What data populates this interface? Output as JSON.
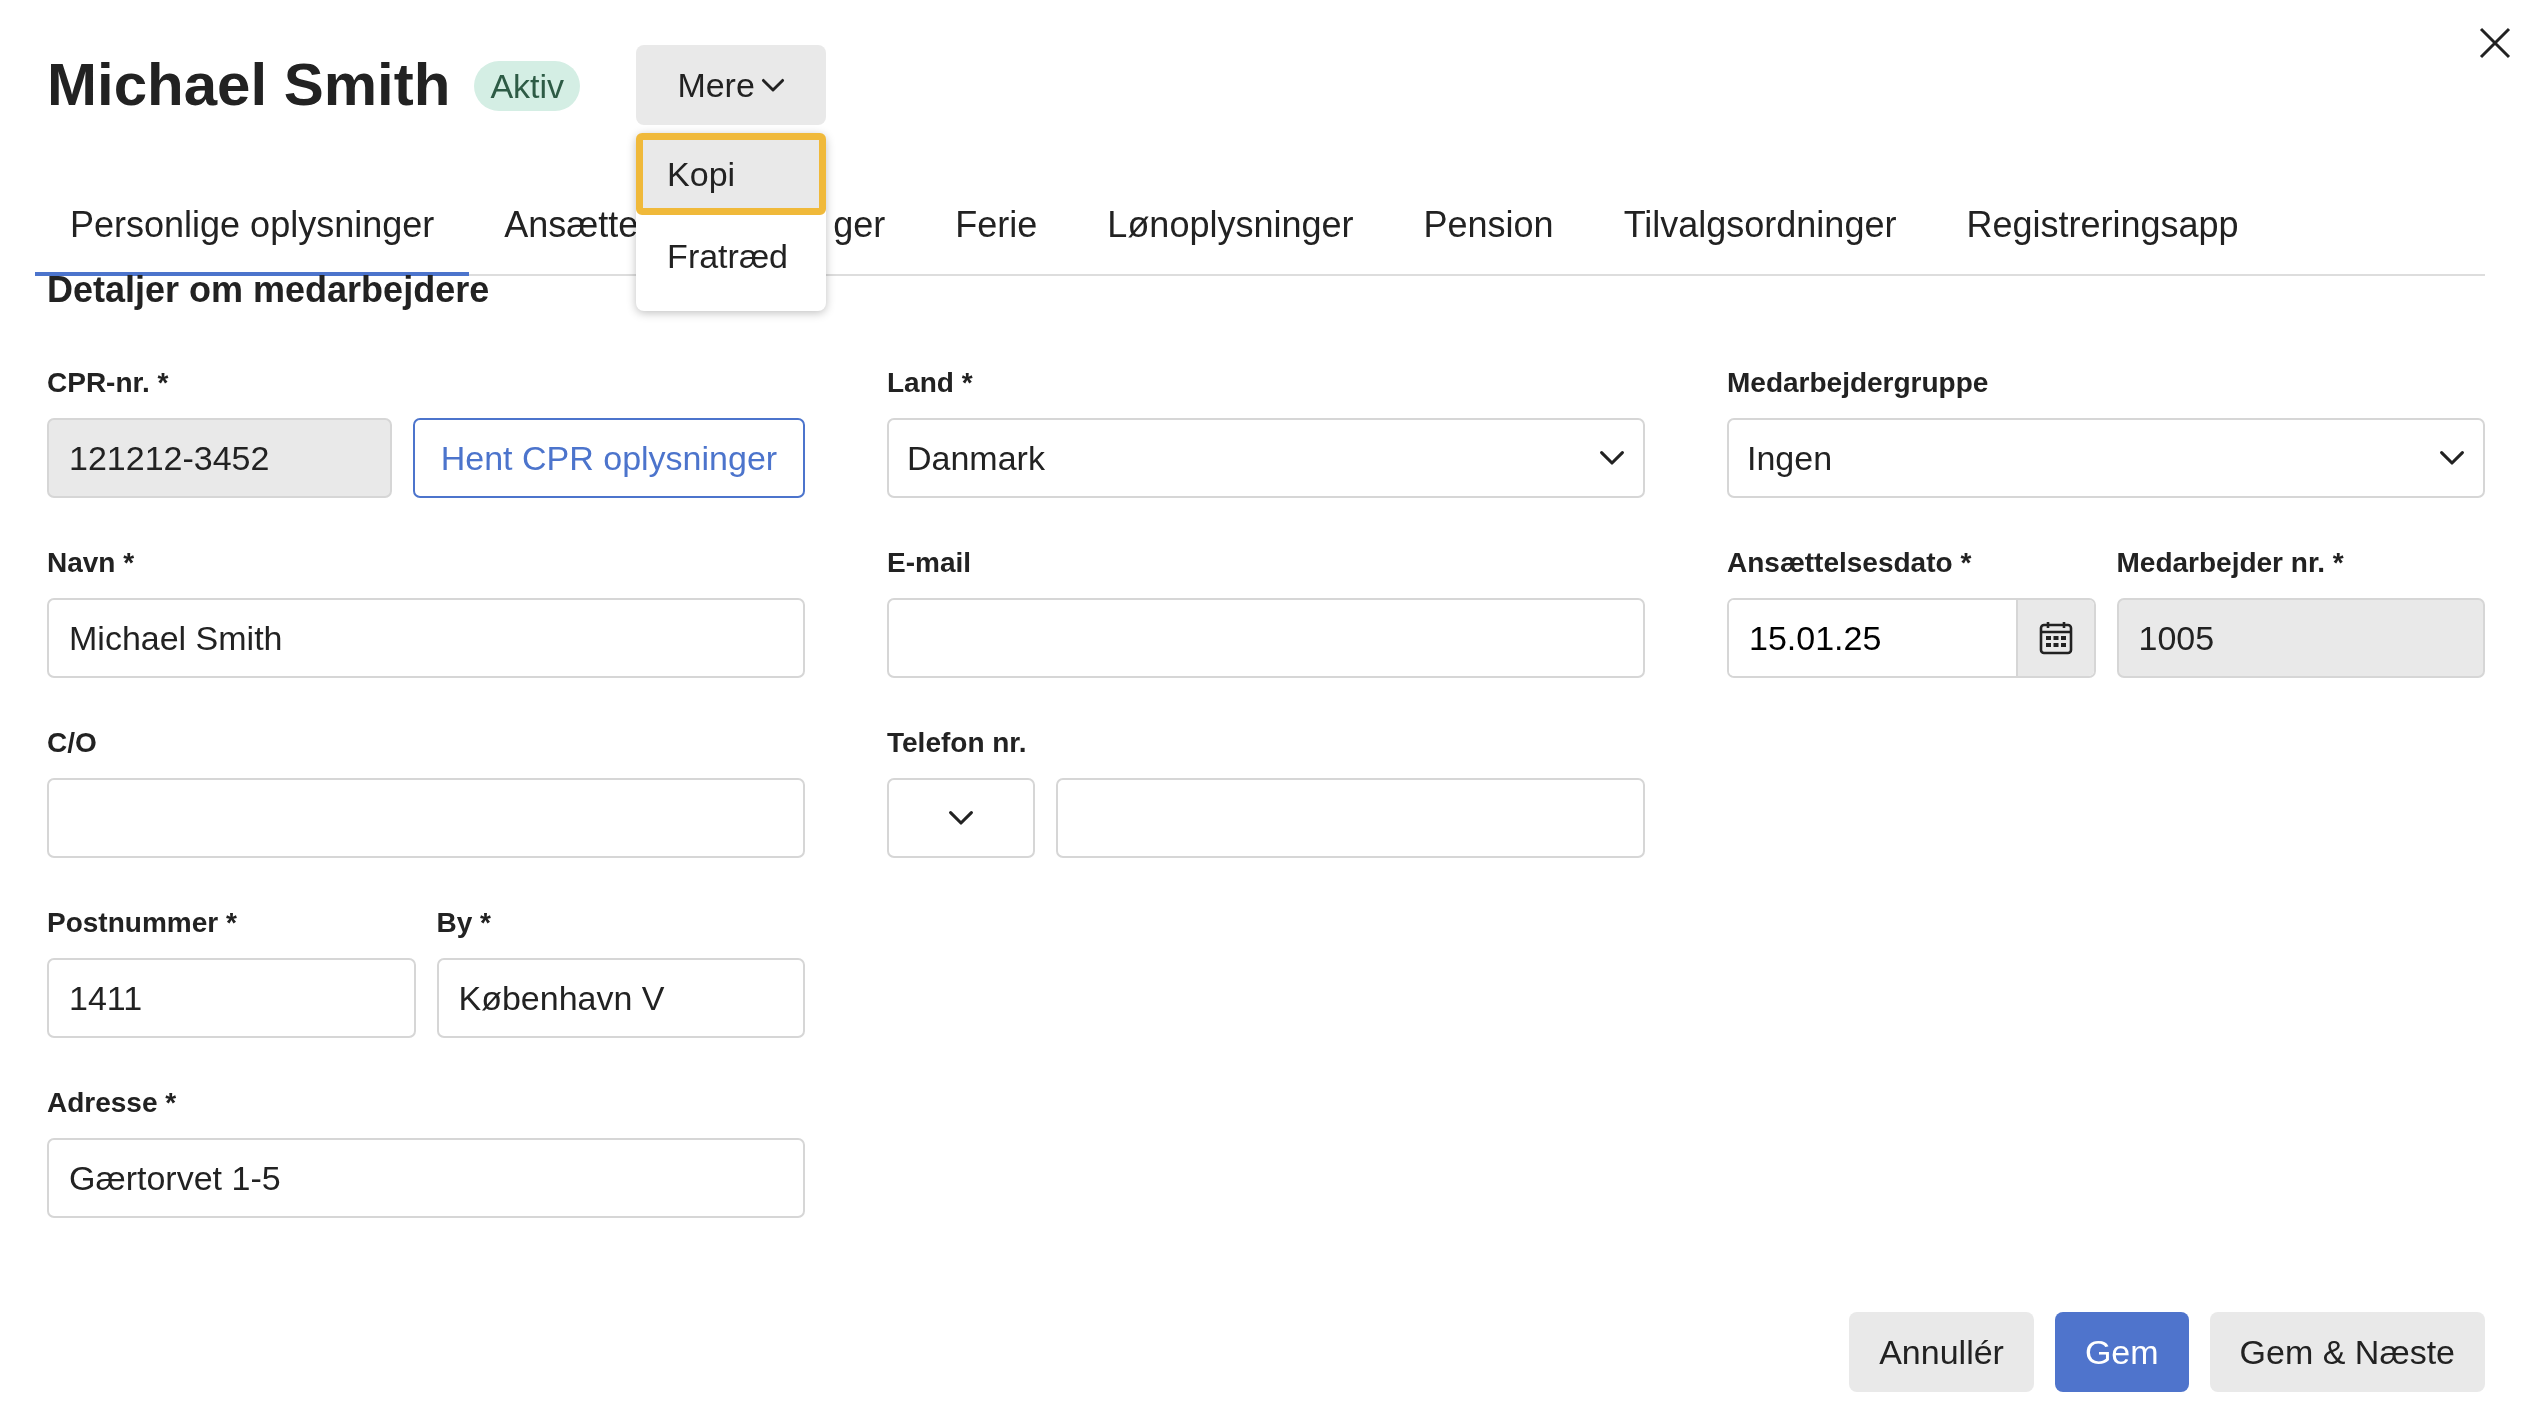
{
  "header": {
    "title": "Michael Smith",
    "status_badge": "Aktiv",
    "more_button": "Mere"
  },
  "more_menu": {
    "open": true,
    "items": [
      {
        "label": "Kopi",
        "focused": true
      },
      {
        "label": "Fratræd",
        "focused": false
      }
    ]
  },
  "tabs": [
    {
      "label": "Personlige oplysninger",
      "selected": true
    },
    {
      "label": "Ansætte",
      "label_after_menu": "ger",
      "selected": false
    },
    {
      "label": "Ferie",
      "selected": false
    },
    {
      "label": "Lønoplysninger",
      "selected": false
    },
    {
      "label": "Pension",
      "selected": false
    },
    {
      "label": "Tilvalgsordninger",
      "selected": false
    },
    {
      "label": "Registreringsapp",
      "selected": false
    }
  ],
  "section_title": "Detaljer om medarbejdere",
  "columns": [
    {
      "groups": [
        [
          {
            "label": "CPR-nr. *",
            "controls": [
              {
                "kind": "input",
                "value": "121212-3452",
                "disabled": true
              },
              {
                "kind": "button",
                "text": "Hent CPR oplysninger"
              }
            ]
          }
        ],
        [
          {
            "label": "Navn *",
            "controls": [
              {
                "kind": "input",
                "value": "Michael Smith",
                "disabled": false
              }
            ]
          }
        ],
        [
          {
            "label": "C/O",
            "controls": [
              {
                "kind": "input",
                "disabled": false
              }
            ]
          }
        ],
        [
          {
            "label": "Postnummer *",
            "controls": [
              {
                "kind": "input",
                "value": "1411",
                "disabled": false
              }
            ]
          },
          {
            "label": "By *",
            "controls": [
              {
                "kind": "input",
                "value": "København V",
                "disabled": false
              }
            ]
          }
        ],
        [
          {
            "label": "Adresse *",
            "controls": [
              {
                "kind": "input",
                "value": "Gærtorvet 1-5",
                "disabled": false
              }
            ]
          }
        ]
      ]
    },
    {
      "groups": [
        [
          {
            "label": "Land *",
            "controls": [
              {
                "kind": "select",
                "value": "Danmark"
              }
            ]
          }
        ],
        [
          {
            "label": "E-mail",
            "controls": [
              {
                "kind": "input",
                "disabled": false
              }
            ]
          }
        ],
        [
          {
            "label": "Telefon nr.",
            "controls": [
              {
                "kind": "select"
              },
              {
                "kind": "input",
                "disabled": false
              }
            ]
          }
        ]
      ]
    },
    {
      "groups": [
        [
          {
            "label": "Medarbejdergruppe",
            "controls": [
              {
                "kind": "select",
                "value": "Ingen"
              }
            ]
          }
        ],
        [
          {
            "label": "Ansættelsesdato *",
            "controls": [
              {
                "kind": "date",
                "value": "15.01.25"
              }
            ]
          },
          {
            "label": "Medarbejder nr. *",
            "controls": [
              {
                "kind": "input",
                "value": "1005",
                "disabled": true
              }
            ]
          }
        ]
      ]
    }
  ],
  "footer_buttons": [
    {
      "text": "Annullér",
      "primary": false
    },
    {
      "text": "Gem",
      "primary": true
    },
    {
      "text": "Gem & Næste",
      "primary": false
    }
  ]
}
